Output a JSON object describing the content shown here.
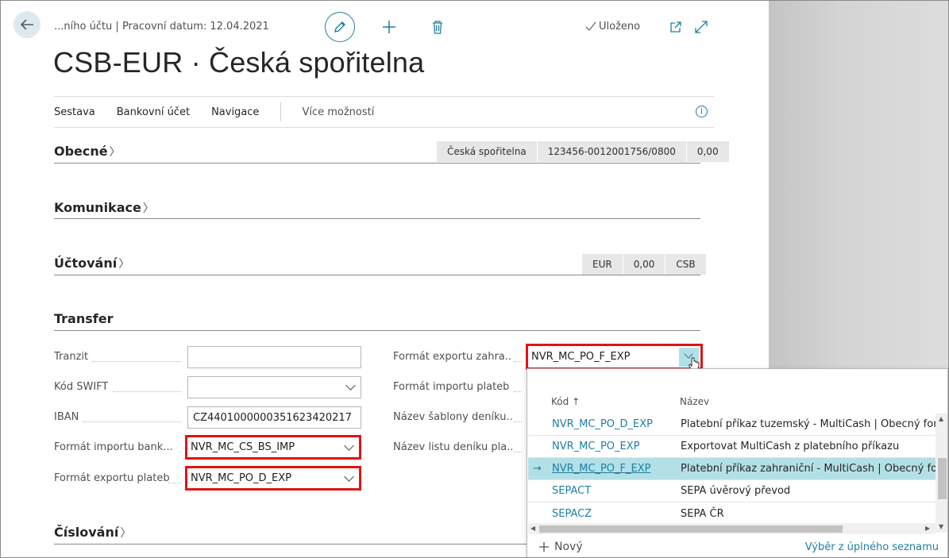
{
  "header": {
    "breadcrumb": "...ního účtu | Pracovní datum: 12.04.2021",
    "saved_label": "Uloženo",
    "title": "CSB-EUR · Česká spořitelna"
  },
  "actionbar": {
    "items": [
      "Sestava",
      "Bankovní účet",
      "Navigace"
    ],
    "more": "Více možností"
  },
  "sections": {
    "general": {
      "title": "Obecné",
      "summary": [
        "Česká spořitelna",
        "123456-0012001756/0800",
        "0,00"
      ]
    },
    "communication": {
      "title": "Komunikace"
    },
    "posting": {
      "title": "Účtování",
      "summary": [
        "EUR",
        "0,00",
        "CSB"
      ]
    },
    "transfer": {
      "title": "Transfer"
    },
    "numbering": {
      "title": "Číslování"
    }
  },
  "transfer_fields": {
    "left": [
      {
        "label": "Tranzit",
        "value": ""
      },
      {
        "label": "Kód SWIFT",
        "value": ""
      },
      {
        "label": "IBAN",
        "value": "CZ4401000000351623420217"
      },
      {
        "label": "Formát importu bank...",
        "value": "NVR_MC_CS_BS_IMP"
      },
      {
        "label": "Formát exportu plateb",
        "value": "NVR_MC_PO_D_EXP"
      }
    ],
    "right": [
      {
        "label": "Formát exportu zahra...",
        "value": "NVR_MC_PO_F_EXP"
      },
      {
        "label": "Formát importu plateb",
        "value": ""
      },
      {
        "label": "Název šablony deníku...",
        "value": ""
      },
      {
        "label": "Název listu deníku pla...",
        "value": ""
      }
    ]
  },
  "lookup": {
    "col_code": "Kód",
    "col_name": "Název",
    "sort_indicator": "↑",
    "rows": [
      {
        "code": "NVR_MC_PO_D_EXP",
        "name": "Platební příkaz tuzemský - MultiCash | Obecný formát"
      },
      {
        "code": "NVR_MC_PO_EXP",
        "name": "Exportovat MultiCash z platebního příkazu"
      },
      {
        "code": "NVR_MC_PO_F_EXP",
        "name": "Platební příkaz zahraniční - MultiCash | Obecný formát"
      },
      {
        "code": "SEPACT",
        "name": "SEPA úvěrový převod"
      },
      {
        "code": "SEPACZ",
        "name": "SEPA ČR"
      }
    ],
    "selected_index": 2,
    "new_label": "Nový",
    "full_list_label": "Výběr z úplného seznamu"
  },
  "colors": {
    "accent": "#1d7fa3",
    "highlight_border": "#e01414",
    "selected_row": "#b3e0e6"
  }
}
